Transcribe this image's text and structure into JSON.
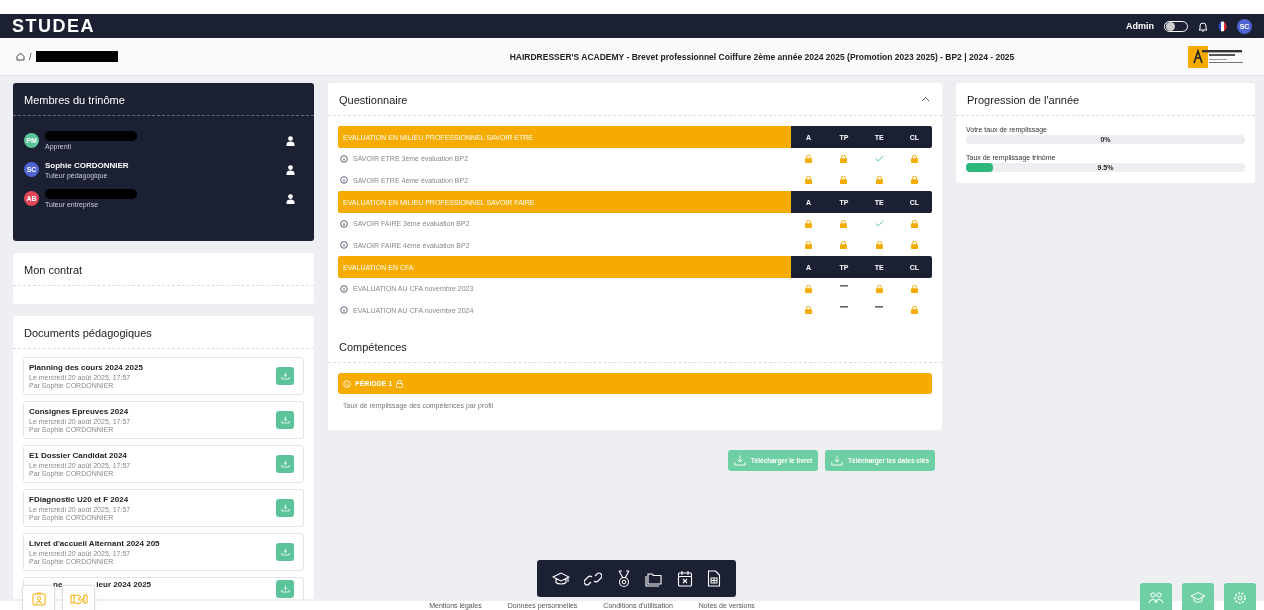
{
  "navbar": {
    "logo": "STUDEA",
    "admin_label": "Admin",
    "admin_toggle": {
      "on": false
    },
    "avatar": "SC"
  },
  "breadcrumb": {
    "separator": "/",
    "title": "HAIRDRESSER'S ACADEMY - Brevet professionnel Coiffure 2ème année 2024 2025 (Promotion 2023 2025) - BP2 | 2024 - 2025"
  },
  "members": {
    "title": "Membres du trinôme",
    "items": [
      {
        "initials": "PM",
        "color": "#5cc49a",
        "name_redacted": true,
        "role": "Apprenti"
      },
      {
        "initials": "SC",
        "color": "#4f63d2",
        "name": "Sophie CORDONNIER",
        "role": "Tuteur pédagogique"
      },
      {
        "initials": "AB",
        "color": "#e0485a",
        "name_redacted": true,
        "role": "Tuteur entreprise"
      }
    ]
  },
  "contract": {
    "title": "Mon contrat"
  },
  "documents": {
    "title": "Documents pédagogiques",
    "items": [
      {
        "title": "Planning des cours 2024 2025",
        "date": "Le mercredi 20 août 2025, 17:57",
        "author": "Par Sophie CORDONNIER"
      },
      {
        "title": "Consignes Epreuves 2024",
        "date": "Le mercredi 20 août 2025, 17:57",
        "author": "Par Sophie CORDONNIER"
      },
      {
        "title": "E1 Dossier Candidat 2024",
        "date": "Le mercredi 20 août 2025, 17:57",
        "author": "Par Sophie CORDONNIER"
      },
      {
        "title": "FDiagnostic U20 et F 2024",
        "date": "Le mercredi 20 août 2025, 17:57",
        "author": "Par Sophie CORDONNIER"
      },
      {
        "title": "Livret d'accueil Alternant 2024 205",
        "date": "Le mercredi 20 août 2025, 17:57",
        "author": "Par Sophie CORDONNIER"
      },
      {
        "title_parts": [
          "ne",
          "ieur 2024 2025"
        ]
      }
    ]
  },
  "questionnaire": {
    "title": "Questionnaire",
    "expanded": true,
    "sections": [
      {
        "title": "EVALUATION EN MILIEU PROFESSIONNEL SAVOIR ETRE",
        "columns": [
          "A",
          "TP",
          "TE",
          "CL"
        ],
        "rows": [
          {
            "label": "SAVOIR ETRE 3ème évaluation BP2",
            "cells": [
              {
                "kind": "lock"
              },
              {
                "kind": "lock"
              },
              {
                "kind": "check"
              },
              {
                "kind": "lock"
              }
            ]
          },
          {
            "label": "SAVOIR ETRE 4ème évaluation BP2",
            "cells": [
              {
                "kind": "lock"
              },
              {
                "kind": "lock"
              },
              {
                "kind": "lock"
              },
              {
                "kind": "lock"
              }
            ]
          }
        ]
      },
      {
        "title": "EVALUATION EN MILIEU PROFESSIONNEL SAVOIR FAIRE",
        "columns": [
          "A",
          "TP",
          "TE",
          "CL"
        ],
        "rows": [
          {
            "label": "SAVOIR FAIRE 3ème évaluation BP2",
            "cells": [
              {
                "kind": "lock"
              },
              {
                "kind": "lock"
              },
              {
                "kind": "check"
              },
              {
                "kind": "lock"
              }
            ]
          },
          {
            "label": "SAVOIR FAIRE 4ème évaluation BP2",
            "cells": [
              {
                "kind": "lock"
              },
              {
                "kind": "lock"
              },
              {
                "kind": "lock"
              },
              {
                "kind": "lock"
              }
            ]
          }
        ]
      },
      {
        "title": "EVALUATION EN CFA",
        "columns": [
          "A",
          "TP",
          "TE",
          "CL"
        ],
        "rows": [
          {
            "label": "EVALUATION AU CFA novembre 2023",
            "cells": [
              {
                "kind": "lock"
              },
              {
                "kind": "dash"
              },
              {
                "kind": "lock"
              },
              {
                "kind": "lock"
              }
            ]
          },
          {
            "label": "EVALUATION AU CFA novembre 2024",
            "cells": [
              {
                "kind": "lock"
              },
              {
                "kind": "dash"
              },
              {
                "kind": "dash"
              },
              {
                "kind": "lock"
              }
            ]
          }
        ]
      }
    ]
  },
  "competences": {
    "title": "Compétences",
    "period": "PÉRIODE 1",
    "caption": "Taux de remplissage des compétences par profil"
  },
  "downloads": [
    "Télécharger le livret",
    "Télécharger les dates clés"
  ],
  "progression": {
    "title": "Progression de l'année",
    "meters": [
      {
        "label": "Votre taux de remplissage",
        "level": 0,
        "reading": "0%"
      },
      {
        "label": "Taux de remplissage trinôme",
        "level": 0.095,
        "reading": "9.5%"
      }
    ]
  },
  "footer": [
    "Mentions légales",
    "Données personnelles",
    "Conditions d'utilisation",
    "Notes de versions"
  ]
}
